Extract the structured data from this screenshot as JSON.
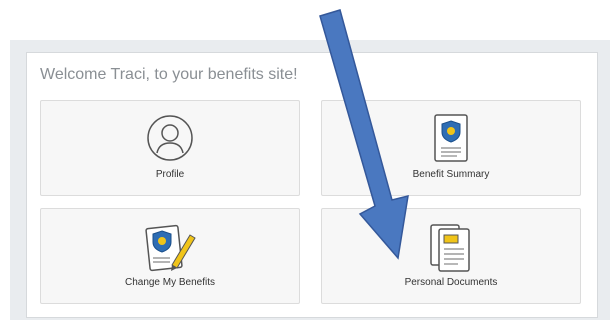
{
  "welcome": "Welcome Traci, to your benefits site!",
  "tiles": [
    {
      "label": "Profile",
      "icon": "user-silhouette-icon"
    },
    {
      "label": "Benefit Summary",
      "icon": "benefit-document-icon"
    },
    {
      "label": "Change My Benefits",
      "icon": "edit-benefits-icon"
    },
    {
      "label": "Personal Documents",
      "icon": "documents-icon"
    }
  ],
  "colors": {
    "panel_border": "#d6d9dc",
    "tile_bg": "#f7f7f7",
    "arrow": "#4a78c0",
    "shield": "#2e6db4",
    "coin": "#f0c419"
  }
}
